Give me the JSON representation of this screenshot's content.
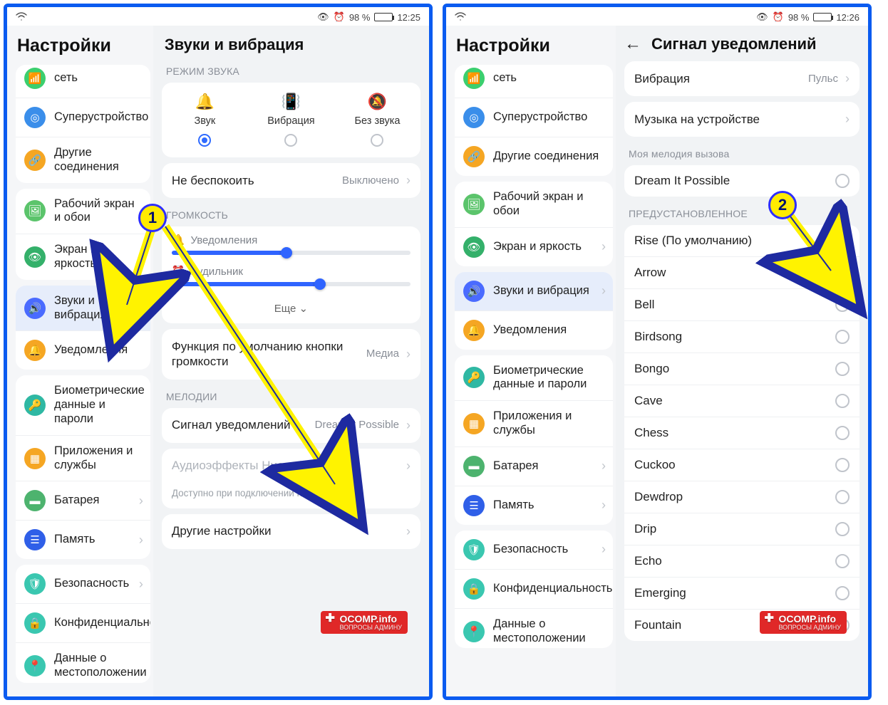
{
  "status": {
    "battery": "98 %",
    "time1": "12:25",
    "time2": "12:26"
  },
  "sidebar": {
    "title": "Настройки",
    "g1": {
      "i0": "сеть",
      "i1": "Суперустройство",
      "i2": "Другие соединения"
    },
    "g2": {
      "i0": "Рабочий экран и обои",
      "i1": "Экран и яркость"
    },
    "g3": {
      "i0": "Звуки и вибрация",
      "i1": "Уведомления"
    },
    "g4": {
      "i0": "Биометрические данные и пароли",
      "i1": "Приложения и службы",
      "i2": "Батарея",
      "i3": "Память"
    },
    "g5": {
      "i0": "Безопасность",
      "i1": "Конфиденциальность",
      "i2": "Данные о местоположении"
    }
  },
  "screen1": {
    "title": "Звуки и вибрация",
    "mode_label": "РЕЖИМ ЗВУКА",
    "modes": {
      "sound": "Звук",
      "vibrate": "Вибрация",
      "silent": "Без звука"
    },
    "dnd": {
      "label": "Не беспокоить",
      "value": "Выключено"
    },
    "volume_label": "ГРОМКОСТЬ",
    "volumes": {
      "notif": "Уведомления",
      "alarm": "Будильник"
    },
    "more": "Еще",
    "volbtn": {
      "label": "Функция по умолчанию кнопки громкости",
      "value": "Медиа"
    },
    "melodies_label": "МЕЛОДИИ",
    "notif_sound": {
      "label": "Сигнал уведомлений",
      "value": "Dream It Possible"
    },
    "histen": "Аудиоэффекты Huawei Histen",
    "histen_hint": "Доступно при подключении наушников",
    "other": "Другие настройки"
  },
  "screen2": {
    "title": "Сигнал уведомлений",
    "vibration": {
      "label": "Вибрация",
      "value": "Пульс"
    },
    "device_music": "Музыка на устройстве",
    "my_ring_label": "Моя мелодия вызова",
    "my_ring": "Dream It Possible",
    "preset_label": "ПРЕДУСТАНОВЛЕННОЕ",
    "tones": {
      "t0": "Rise (По умолчанию)",
      "t1": "Arrow",
      "t2": "Bell",
      "t3": "Birdsong",
      "t4": "Bongo",
      "t5": "Cave",
      "t6": "Chess",
      "t7": "Cuckoo",
      "t8": "Dewdrop",
      "t9": "Drip",
      "t10": "Echo",
      "t11": "Emerging",
      "t12": "Fountain"
    }
  },
  "annotations": {
    "b1": "1",
    "b2": "2"
  },
  "watermark": {
    "main": "OCOMP.info",
    "sub": "ВОПРОСЫ АДМИНУ"
  }
}
